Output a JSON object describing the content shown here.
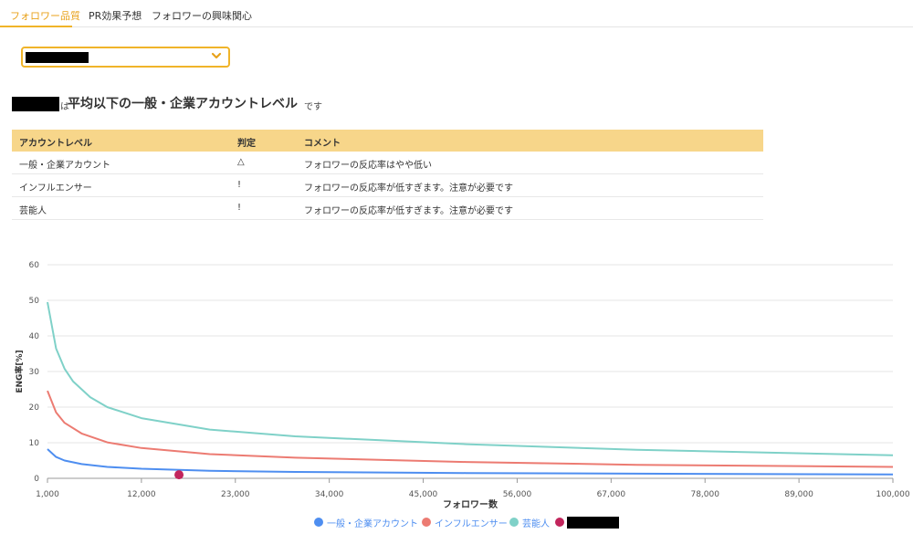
{
  "tabs": [
    {
      "label": "フォロワー品質",
      "active": true
    },
    {
      "label": "PR効果予想",
      "active": false
    },
    {
      "label": "フォロワーの興味関心",
      "active": false
    }
  ],
  "headline": {
    "particle": "は",
    "main": "平均以下の一般・企業アカウントレベル",
    "suffix": "です"
  },
  "table": {
    "headers": [
      "アカウントレベル",
      "判定",
      "コメント"
    ],
    "rows": [
      [
        "一般・企業アカウント",
        "△",
        "フォロワーの反応率はやや低い"
      ],
      [
        "インフルエンサー",
        "!",
        "フォロワーの反応率が低すぎます。注意が必要です"
      ],
      [
        "芸能人",
        "!",
        "フォロワーの反応率が低すぎます。注意が必要です"
      ]
    ]
  },
  "chart_data": {
    "type": "line",
    "xlabel": "フォロワー数",
    "ylabel": "ENG率[%]",
    "xlim": [
      1000,
      100000
    ],
    "ylim": [
      0,
      60
    ],
    "xticks": [
      1000,
      12000,
      23000,
      34000,
      45000,
      56000,
      67000,
      78000,
      89000,
      100000
    ],
    "xtick_labels": [
      "1,000",
      "12,000",
      "23,000",
      "34,000",
      "45,000",
      "56,000",
      "67,000",
      "78,000",
      "89,000",
      "100,000"
    ],
    "yticks": [
      0,
      10,
      20,
      30,
      40,
      50,
      60
    ],
    "ytick_labels": [
      "0",
      "10",
      "20",
      "30",
      "40",
      "50",
      "60"
    ],
    "grid": true,
    "legend_position": "bottom",
    "series": [
      {
        "name": "一般・企業アカウント",
        "color": "#4e8ef0",
        "x": [
          1000,
          2000,
          3000,
          5000,
          8000,
          12000,
          20000,
          30000,
          50000,
          70000,
          100000
        ],
        "y": [
          8.2,
          6.0,
          5.0,
          4.0,
          3.2,
          2.7,
          2.1,
          1.8,
          1.5,
          1.3,
          1.1
        ]
      },
      {
        "name": "インフルエンサー",
        "color": "#ec7b72",
        "x": [
          1000,
          2000,
          3000,
          5000,
          8000,
          12000,
          20000,
          30000,
          50000,
          70000,
          100000
        ],
        "y": [
          24.6,
          18.5,
          15.6,
          12.6,
          10.1,
          8.5,
          6.8,
          5.8,
          4.6,
          3.8,
          3.2
        ]
      },
      {
        "name": "芸能人",
        "color": "#7fd1c8",
        "x": [
          1000,
          2000,
          3000,
          4000,
          6000,
          8000,
          12000,
          20000,
          30000,
          50000,
          70000,
          100000
        ],
        "y": [
          49.5,
          36.5,
          30.8,
          27.2,
          22.8,
          20.0,
          16.9,
          13.7,
          11.8,
          9.6,
          8.0,
          6.5
        ]
      }
    ],
    "highlight_point": {
      "x": 16400,
      "y": 1.0,
      "color": "#c2255c"
    }
  },
  "colors": {
    "accent": "#f0b429",
    "table_header": "#f7d68a",
    "legend_text": "#4e8ef0"
  }
}
